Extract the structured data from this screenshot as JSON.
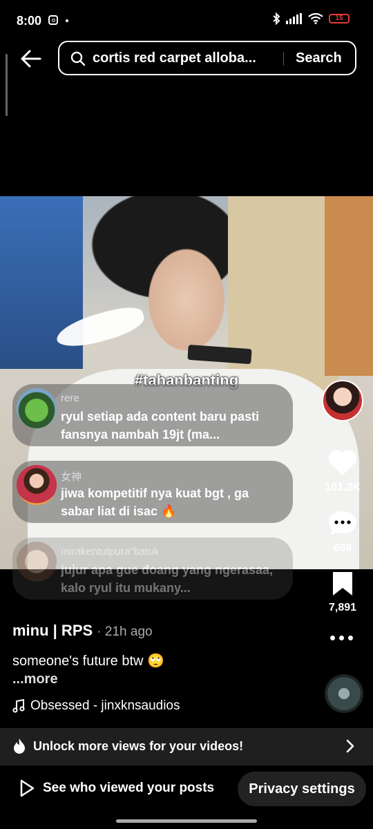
{
  "status_bar": {
    "time": "8:00",
    "battery": "15"
  },
  "search": {
    "query": "cortis red carpet alloba...",
    "button_label": "Search"
  },
  "video": {
    "hashtag": "#tahanbanting"
  },
  "comments": [
    {
      "user": "rere",
      "text": "ryul setiap ada content baru pasti fansnya nambah 19jt (ma..."
    },
    {
      "user": "女神",
      "text": "jiwa kompetitif nya kuat bgt , ga sabar liat di isac 🔥"
    },
    {
      "user": "mirakentutpura\"batuk",
      "text": "jujur apa gue doang yang ngerasaa, kalo ryul itu mukany..."
    }
  ],
  "actions": {
    "likes": "101.2K",
    "comments": "688",
    "saves": "7,891"
  },
  "post": {
    "author": "minu | RPS",
    "time_ago": "· 21h ago",
    "caption": "someone's future btw 🙄",
    "more": "...more",
    "music": "Obsessed - jinxknsaudios"
  },
  "banner": {
    "text": "Unlock more views for your videos!"
  },
  "bottom": {
    "see_who": "See who viewed your posts",
    "privacy": "Privacy settings"
  },
  "colors": {
    "battery_low": "#e53935",
    "banner_bg": "#1f1f1f"
  }
}
